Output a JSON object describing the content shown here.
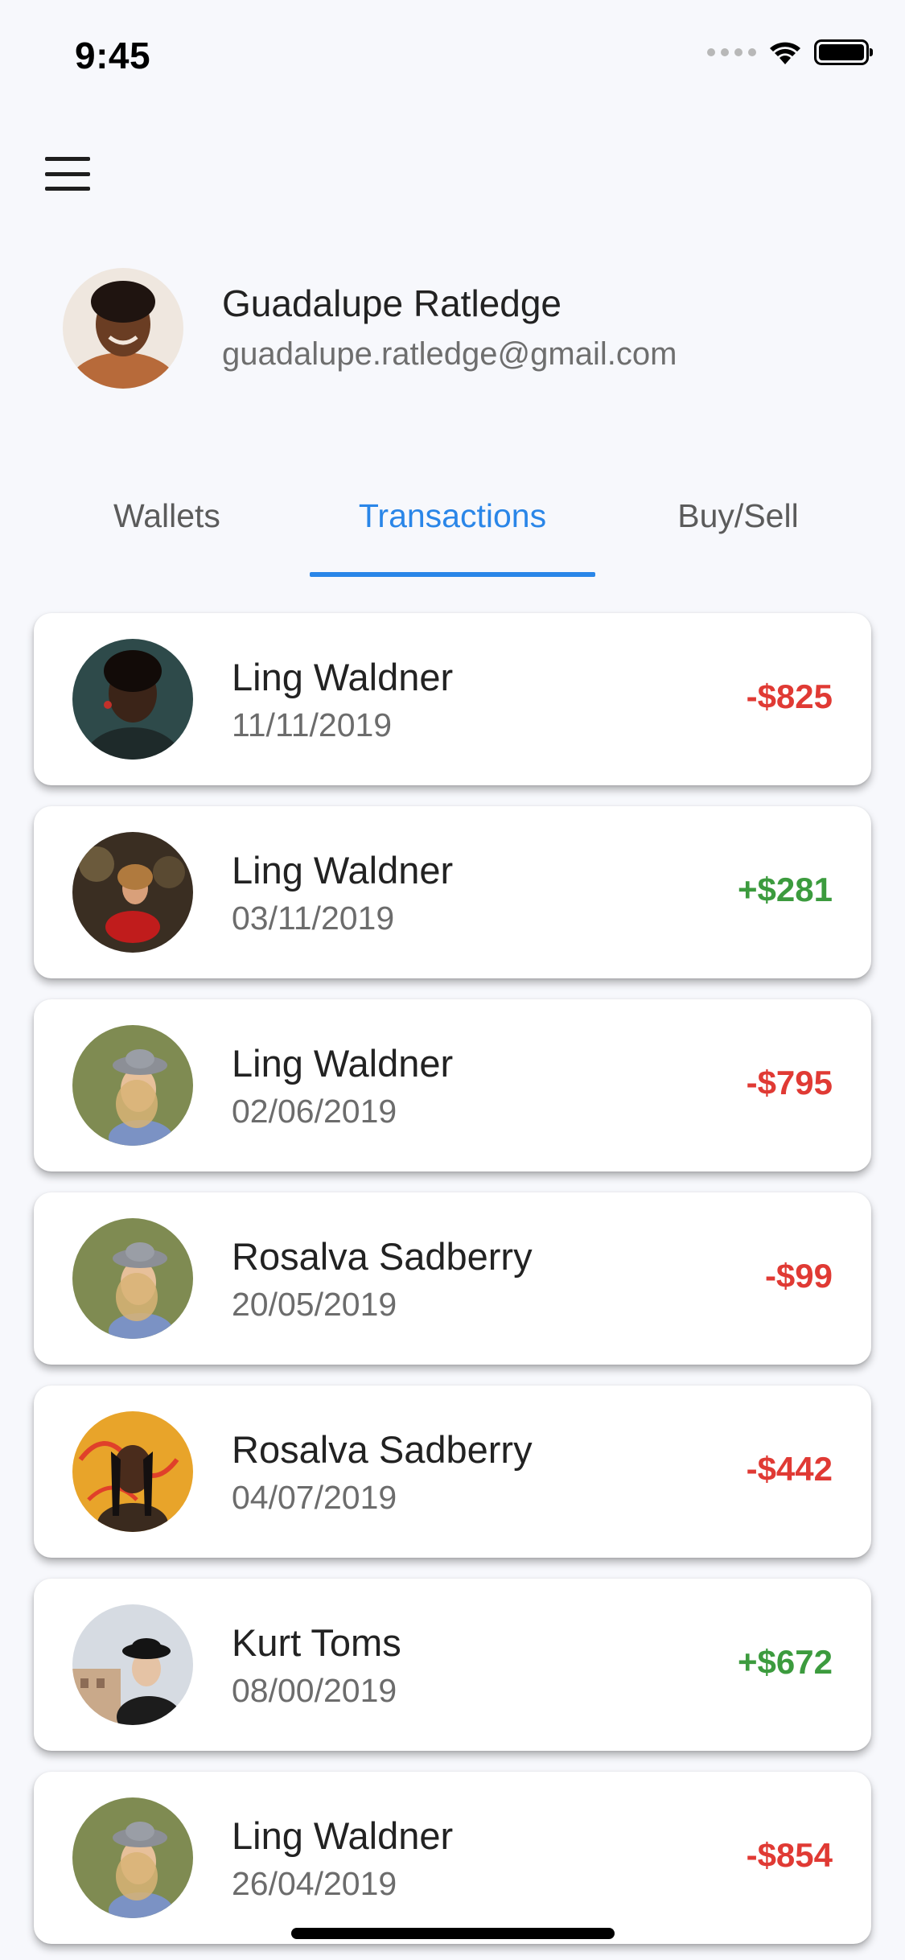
{
  "status_bar": {
    "time": "9:45",
    "icons": [
      "signal-dots-icon",
      "wifi-icon",
      "battery-icon"
    ]
  },
  "header": {
    "menu_icon": "hamburger-menu-icon"
  },
  "profile": {
    "name": "Guadalupe Ratledge",
    "email": "guadalupe.ratledge@gmail.com"
  },
  "tabs": [
    {
      "label": "Wallets",
      "active": false
    },
    {
      "label": "Transactions",
      "active": true
    },
    {
      "label": "Buy/Sell",
      "active": false
    }
  ],
  "colors": {
    "accent": "#2a86e8",
    "negative": "#e03a34",
    "positive": "#3c9b3e",
    "background": "#f7f8fc"
  },
  "transactions": [
    {
      "name": "Ling Waldner",
      "date": "11/11/2019",
      "amount": "-$825",
      "type": "neg"
    },
    {
      "name": "Ling Waldner",
      "date": "03/11/2019",
      "amount": "+$281",
      "type": "pos"
    },
    {
      "name": "Ling Waldner",
      "date": "02/06/2019",
      "amount": "-$795",
      "type": "neg"
    },
    {
      "name": "Rosalva Sadberry",
      "date": "20/05/2019",
      "amount": "-$99",
      "type": "neg"
    },
    {
      "name": "Rosalva Sadberry",
      "date": "04/07/2019",
      "amount": "-$442",
      "type": "neg"
    },
    {
      "name": "Kurt Toms",
      "date": "08/00/2019",
      "amount": "+$672",
      "type": "pos"
    },
    {
      "name": "Ling Waldner",
      "date": "26/04/2019",
      "amount": "-$854",
      "type": "neg"
    }
  ]
}
